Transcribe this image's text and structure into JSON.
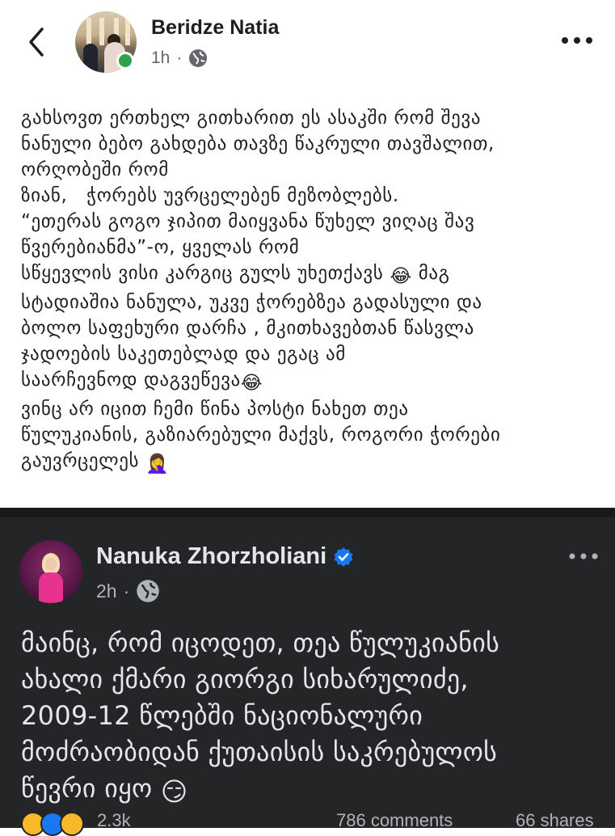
{
  "post": {
    "author": "Beridze Natia",
    "time": "1h",
    "dot": "·",
    "icons": {
      "back": "back-chevron-icon",
      "privacy": "globe-icon",
      "more": "more-dots-icon",
      "status": "online-status-icon"
    },
    "lines": [
      "გახსოვთ ერთხელ გითხარით ეს ასაკში რომ შევა",
      "ნანული ბებო გახდება თავზე წაკრული თავშალით,",
      "ორღობეში რომ",
      "ზიან,   ჭორებს უვრცელებენ მეზობლებს.",
      "“ეთერას გოგო ჯიპით მაიყვანა წუხელ ვიღაც შავ",
      "წვერებიანმა”-ო, ყველას რომ",
      "სწყევლის ვისი კარგიც გულს უხეთქავს",
      "😂",
      "მაგ",
      "სტადიაშია ნანულა, უკვე ჭორებზეა გადასული და",
      "ბოლო საფეხური დარჩა , მკითხავებთან წასვლა",
      "ჯადოების საკეთებლად და ეგაც ამ",
      "საარჩევნოდ დაგვეწევა",
      "😂",
      "ვინც არ იცით ჩემი წინა პოსტი ნახეთ თეა",
      "წულუკიანის, გაზიარებული მაქვს, როგორი ჭორები",
      "გაუვრცელეს",
      "🤦‍♀️"
    ]
  },
  "shared": {
    "author": "Nanuka Zhorzholiani",
    "time": "2h",
    "dot": "·",
    "icons": {
      "verified": "verified-badge-icon",
      "privacy": "globe-icon",
      "more": "more-dots-icon"
    },
    "lines": [
      "მაინც, რომ იცოდეთ, თეა წულუკიანის",
      "ახალი ქმარი გიორგი სიხარულიძე,",
      "2009-12 წლებში ნაციონალური",
      "მოძრაობიდან ქუთაისის საკრებულოს",
      "წევრი იყო",
      "😏"
    ],
    "reactions": {
      "icons": [
        "haha-reaction-icon",
        "like-reaction-icon",
        "care-reaction-icon"
      ],
      "count": "2.3k",
      "comments": "786 comments",
      "shares": "66 shares"
    }
  },
  "colors": {
    "fb_blue": "#1877f2",
    "online_green": "#31a24c",
    "dark_bg": "#242526",
    "dark_text": "#e4e6eb",
    "muted": "#65676b"
  }
}
